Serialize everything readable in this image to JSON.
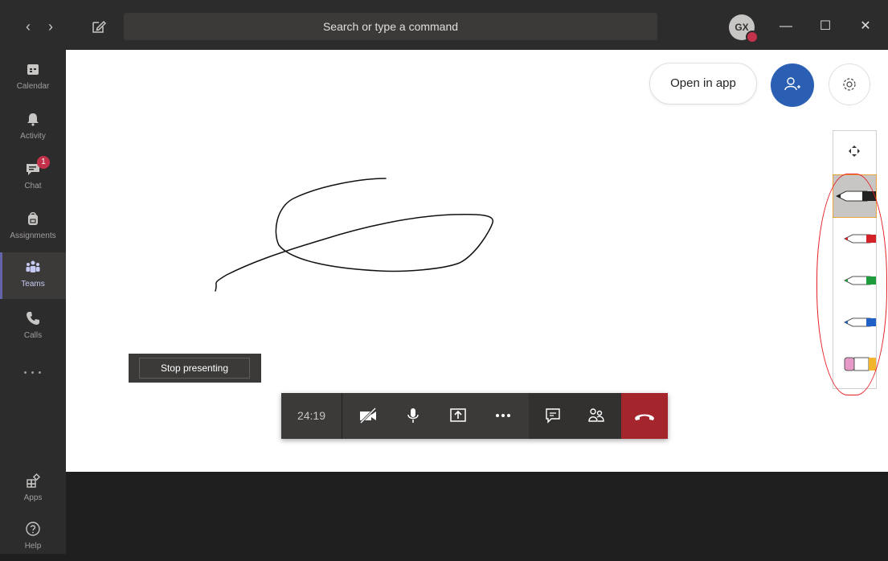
{
  "titlebar": {
    "search_placeholder": "Search or type a command",
    "avatar_initials": "GX"
  },
  "sidebar": {
    "items": [
      {
        "label": "Calendar",
        "icon": "calendar-icon"
      },
      {
        "label": "Activity",
        "icon": "bell-icon"
      },
      {
        "label": "Chat",
        "icon": "chat-icon",
        "badge": "1"
      },
      {
        "label": "Assignments",
        "icon": "backpack-icon"
      },
      {
        "label": "Teams",
        "icon": "teams-icon",
        "active": true
      },
      {
        "label": "Calls",
        "icon": "phone-icon"
      }
    ],
    "more": "• • •",
    "bottom": [
      {
        "label": "Apps",
        "icon": "apps-icon"
      },
      {
        "label": "Help",
        "icon": "help-icon"
      }
    ]
  },
  "whiteboard": {
    "open_in_app_label": "Open in app",
    "pens": [
      {
        "name": "black-pen",
        "color": "#222222",
        "selected": true
      },
      {
        "name": "red-pen",
        "color": "#d42027"
      },
      {
        "name": "green-pen",
        "color": "#1e9b3c"
      },
      {
        "name": "blue-pen",
        "color": "#2160c4"
      },
      {
        "name": "highlighter",
        "color": "#f3b52e",
        "accent": "#e79ac8"
      }
    ]
  },
  "presenting": {
    "stop_label": "Stop presenting"
  },
  "call_controls": {
    "timer": "24:19"
  },
  "colors": {
    "accent": "#6264a7",
    "invite_blue": "#2b5fb4",
    "hangup_red": "#a4262c",
    "annotation_red": "#e51c23"
  }
}
